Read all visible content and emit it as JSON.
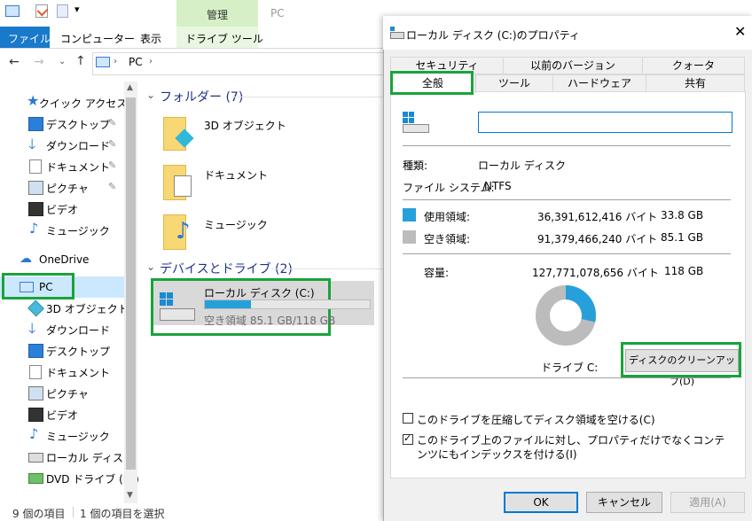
{
  "explorer": {
    "qat": {
      "title_context": "管理",
      "title_location": "PC"
    },
    "tabs": {
      "file": "ファイル",
      "computer": "コンピューター",
      "view": "表示",
      "drive_tools": "ドライブ ツール"
    },
    "address": {
      "pc": "PC"
    },
    "nav": {
      "quick_access": "クイック アクセス",
      "qa_items": [
        "デスクトップ",
        "ダウンロード",
        "ドキュメント",
        "ピクチャ",
        "ビデオ",
        "ミュージック"
      ],
      "onedrive": "OneDrive",
      "pc": "PC",
      "pc_items": [
        "3D オブジェクト",
        "ダウンロード",
        "デスクトップ",
        "ドキュメント",
        "ピクチャ",
        "ビデオ",
        "ミュージック",
        "ローカル ディスク (C",
        "DVD ドライブ (D:)"
      ]
    },
    "folders": {
      "header": "フォルダー (7)",
      "items": [
        "3D オブジェクト",
        "ドキュメント",
        "ミュージック"
      ]
    },
    "devices": {
      "header": "デバイスとドライブ (2)",
      "drive_name": "ローカル ディスク (C:)",
      "drive_space": "空き領域 85.1 GB/118 GB",
      "used_fraction": 0.28
    },
    "status": {
      "count": "9 個の項目",
      "selected": "1 個の項目を選択"
    }
  },
  "dialog": {
    "title": "ローカル ディスク (C:)のプロパティ",
    "tabs_row1": [
      "セキュリティ",
      "以前のバージョン",
      "クォータ"
    ],
    "tabs_row2": [
      "全般",
      "ツール",
      "ハードウェア",
      "共有"
    ],
    "name_value": "",
    "type_label": "種類:",
    "type_value": "ローカル ディスク",
    "fs_label": "ファイル システム:",
    "fs_value": "NTFS",
    "used_label": "使用領域:",
    "used_bytes": "36,391,612,416 バイト",
    "used_gb": "33.8 GB",
    "free_label": "空き領域:",
    "free_bytes": "91,379,466,240 バイト",
    "free_gb": "85.1 GB",
    "capacity_label": "容量:",
    "capacity_bytes": "127,771,078,656 バイト",
    "capacity_gb": "118 GB",
    "drive_label": "ドライブ C:",
    "cleanup_button": "ディスクのクリーンアップ(D)",
    "compress_label": "このドライブを圧縮してディスク領域を空ける(C)",
    "index_label": "このドライブ上のファイルに対し、プロパティだけでなくコンテンツにもインデックスを付ける(I)",
    "ok": "OK",
    "cancel": "キャンセル",
    "apply": "適用(A)",
    "colors": {
      "used": "#26a0da",
      "free": "#bcbcbc"
    },
    "used_fraction": 0.285
  }
}
